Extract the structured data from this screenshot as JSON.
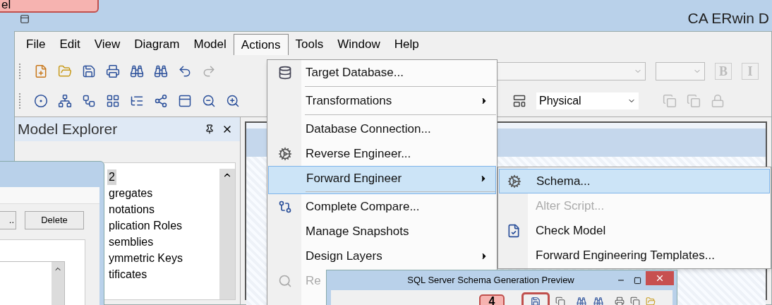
{
  "callout": {
    "text": "el"
  },
  "window": {
    "title": "CA ERwin D"
  },
  "menu_bar": [
    {
      "label": "File",
      "selected": false
    },
    {
      "label": "Edit",
      "selected": false
    },
    {
      "label": "View",
      "selected": false
    },
    {
      "label": "Diagram",
      "selected": false
    },
    {
      "label": "Model",
      "selected": false
    },
    {
      "label": "Actions",
      "selected": true
    },
    {
      "label": "Tools",
      "selected": false
    },
    {
      "label": "Window",
      "selected": false
    },
    {
      "label": "Help",
      "selected": false
    }
  ],
  "toolbar": {
    "format_buttons": [
      "B",
      "I"
    ],
    "layer_combo": "Physical"
  },
  "model_explorer": {
    "title": "Model Explorer",
    "items": [
      {
        "label": "2",
        "selected": true
      },
      {
        "label": "gregates",
        "selected": false
      },
      {
        "label": "notations",
        "selected": false
      },
      {
        "label": "plication Roles",
        "selected": false
      },
      {
        "label": "semblies",
        "selected": false
      },
      {
        "label": "ymmetric Keys",
        "selected": false
      },
      {
        "label": "tificates",
        "selected": false
      }
    ]
  },
  "left_dialog": {
    "buttons": [
      "..",
      "Delete"
    ]
  },
  "actions_menu": [
    {
      "label": "Target Database...",
      "submenu": false,
      "selected": false,
      "disabled": false,
      "separator_after": true
    },
    {
      "label": "Transformations",
      "submenu": true,
      "selected": false,
      "disabled": false,
      "separator_after": true
    },
    {
      "label": "Database Connection...",
      "submenu": false,
      "selected": false,
      "disabled": false,
      "separator_after": false
    },
    {
      "label": "Reverse Engineer...",
      "submenu": false,
      "selected": false,
      "disabled": false,
      "separator_after": false
    },
    {
      "label": "Forward Engineer",
      "submenu": true,
      "selected": true,
      "disabled": false,
      "separator_after": true
    },
    {
      "label": "Complete Compare...",
      "submenu": false,
      "selected": false,
      "disabled": false,
      "separator_after": false
    },
    {
      "label": "Manage Snapshots",
      "submenu": false,
      "selected": false,
      "disabled": false,
      "separator_after": false
    },
    {
      "label": "Design Layers",
      "submenu": true,
      "selected": false,
      "disabled": false,
      "separator_after": false
    },
    {
      "label": "Re",
      "submenu": false,
      "selected": false,
      "disabled": true,
      "separator_after": false
    }
  ],
  "forward_submenu": [
    {
      "label": "Schema...",
      "selected": true,
      "disabled": false
    },
    {
      "label": "Alter Script...",
      "selected": false,
      "disabled": true
    },
    {
      "label": "Check Model",
      "selected": false,
      "disabled": false
    },
    {
      "label": "Forward Engineering Templates...",
      "selected": false,
      "disabled": false
    }
  ],
  "preview_dialog": {
    "title": "SQL Server Schema Generation Preview",
    "callout": "4"
  }
}
